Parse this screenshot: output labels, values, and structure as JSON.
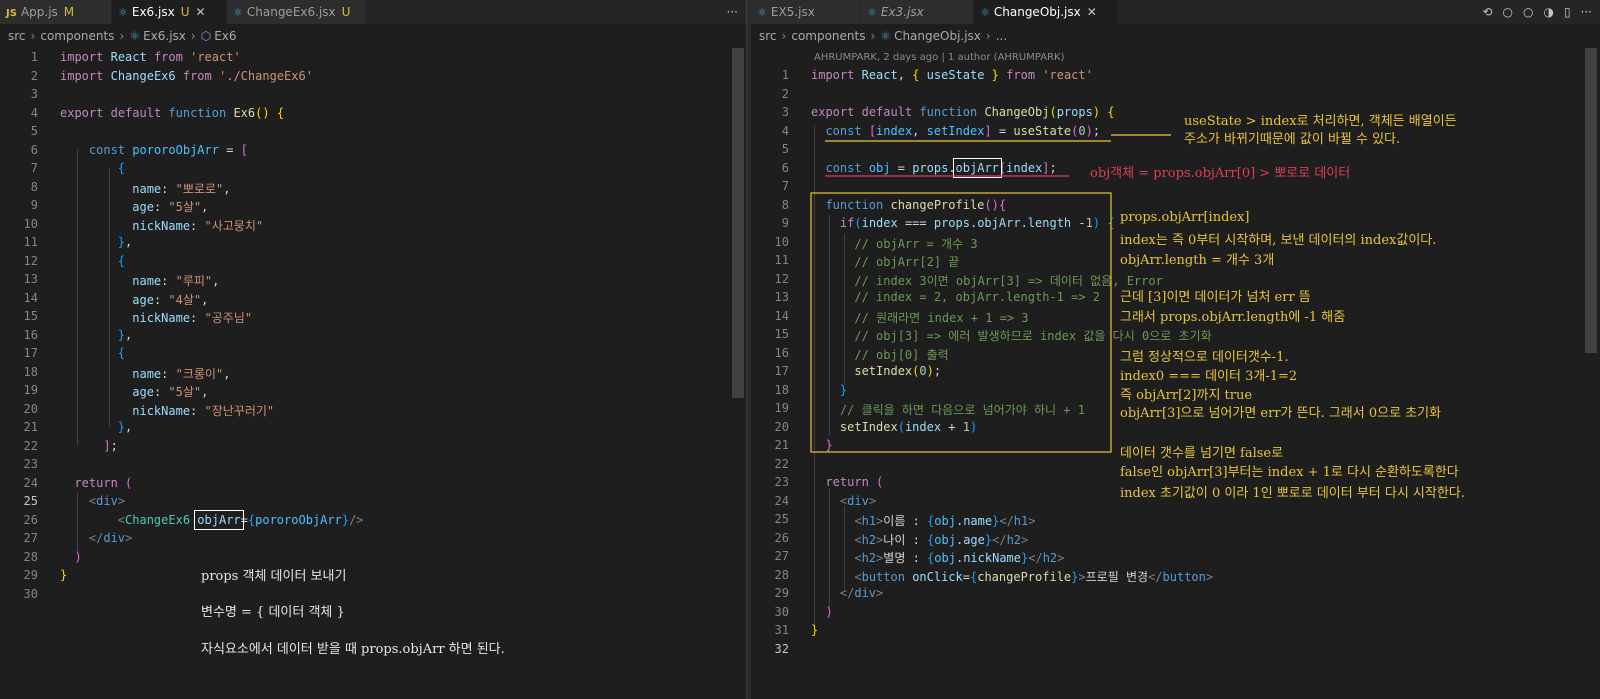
{
  "left": {
    "tabs": [
      {
        "label": "App.js",
        "status": "M",
        "icon": "js-file-icon"
      },
      {
        "label": "Ex6.jsx",
        "status": "U",
        "icon": "react-file-icon"
      },
      {
        "label": "ChangeEx6.jsx",
        "status": "U",
        "icon": "react-file-icon"
      }
    ],
    "more": "···",
    "breadcrumb": [
      "src",
      "components",
      "Ex6.jsx",
      "Ex6"
    ],
    "annotations": [
      "props 객체 데이터 보내기",
      "변수명 = { 데이터 객체 }",
      "자식요소에서 데이터 받을 때 props.objArr 하면 된다."
    ]
  },
  "right": {
    "tabs": [
      {
        "label": "EX5.jsx",
        "icon": "react-file-icon"
      },
      {
        "label": "Ex3.jsx",
        "icon": "react-file-icon"
      },
      {
        "label": "ChangeObj.jsx",
        "icon": "react-file-icon"
      }
    ],
    "actions": [
      "⟲",
      "○",
      "○",
      "◑",
      "▯",
      "···"
    ],
    "breadcrumb": [
      "src",
      "components",
      "ChangeObj.jsx",
      "..."
    ],
    "blame": "AHRUMPARK, 2 days ago | 1 author (AHRUMPARK)",
    "annotations": {
      "state_note": [
        "useState > index로 처리하면, 객체든 배열이든",
        "주소가 바뀌기때문에 값이 바뀔 수 있다."
      ],
      "obj_note": "obj객체 = props.objArr[0] > 뽀로로 데이터",
      "index_note": [
        "props.objArr[index]",
        "index는 즉 0부터 시작하며, 보낸 데이터의 index값이다.",
        "objArr.length = 개수 3개",
        "근데 [3]이면 데이터가 넘처 err 뜸",
        "그래서 props.objArr.length에 -1 해줌",
        "그럼 정상적으로 데이터갯수-1.",
        "index0 === 데이터 3개-1=2",
        "즉 objArr[2]까지 true",
        "objArr[3]으로 넘어가면 err가 뜬다. 그래서 0으로 초기화"
      ],
      "cycle_note": [
        "데이터 갯수를 넘기면 false로",
        "false인 objArr[3]부터는 index + 1로 다시 순환하도록한다",
        "index 초기값이 0 이라 1인 뽀로로 데이터 부터 다시 시작한다."
      ]
    }
  },
  "colors": {
    "annotation_yellow": "#e8c53a",
    "annotation_red": "#e03c5a",
    "annotation_white": "#e6e6e6"
  }
}
